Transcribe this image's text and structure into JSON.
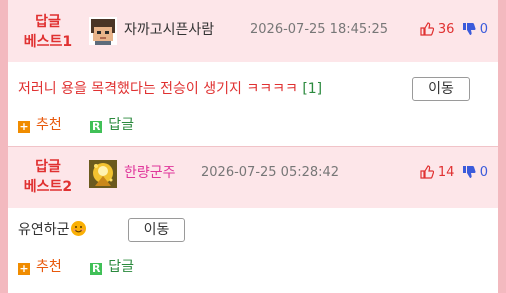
{
  "comments": [
    {
      "badge_line1": "답글",
      "badge_line2": "베스트1",
      "username": "자까고시픈사람",
      "date": "2026-07-25 18:45:25",
      "upvotes": "36",
      "downvotes": "0",
      "body": "저러니 용을 목격했다는 전승이 생기지 ㅋㅋㅋㅋ",
      "reply_count": "[1]",
      "move_label": "이동",
      "recommend_label": "추천",
      "reply_label": "답글"
    },
    {
      "badge_line1": "답글",
      "badge_line2": "베스트2",
      "username": "한량군주",
      "date": "2026-07-25 05:28:42",
      "upvotes": "14",
      "downvotes": "0",
      "body": "유연하군",
      "move_label": "이동",
      "recommend_label": "추천",
      "reply_label": "답글"
    }
  ],
  "icons": {
    "recommend": "plus-square-icon",
    "reply": "r-square-icon",
    "upvote": "thumbs-up-icon",
    "downvote": "thumbs-down-icon",
    "emoji": "smiling-face-icon"
  },
  "colors": {
    "accent_red": "#e03131",
    "header_bg": "#fde6e9",
    "page_border": "#f3b9bf",
    "username_pink": "#e0379b",
    "downvote_blue": "#3b5bdb"
  }
}
